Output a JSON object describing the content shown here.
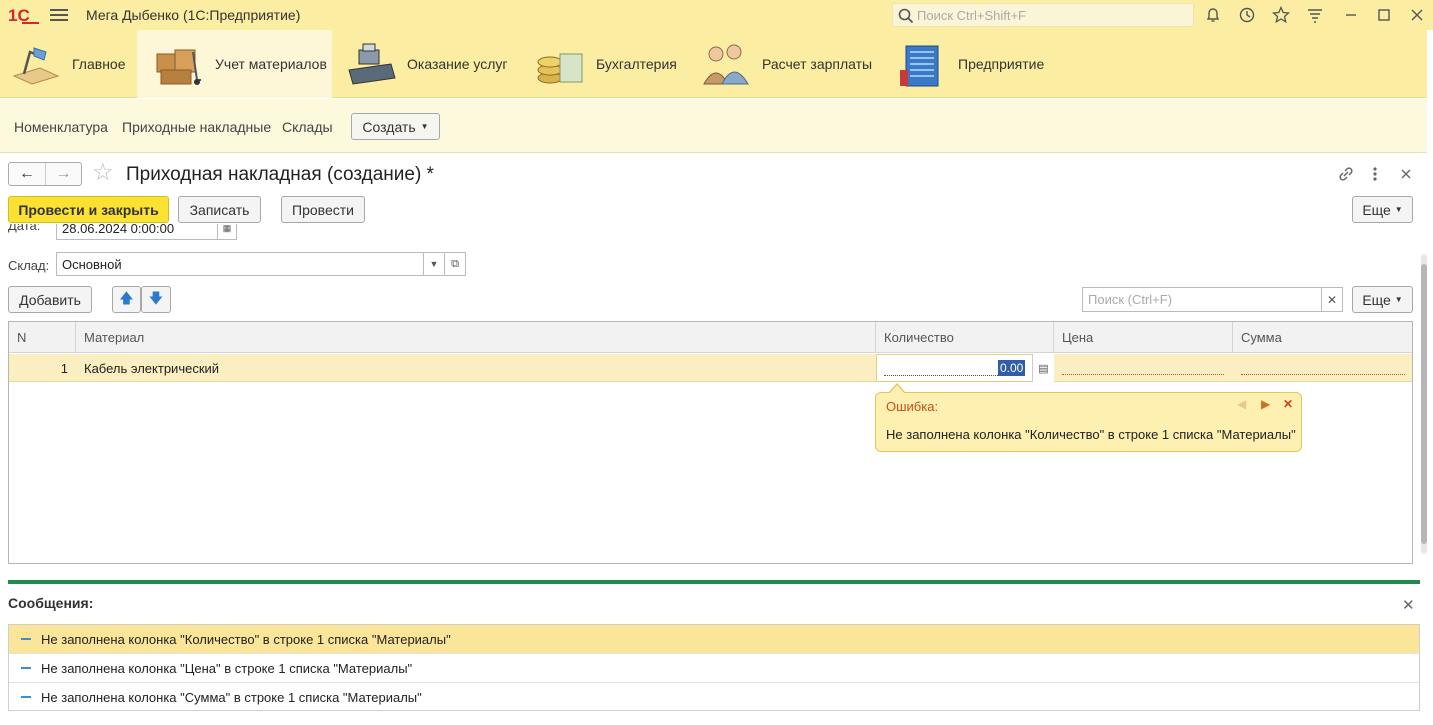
{
  "app": {
    "logo_text": "1С",
    "title": "Мега Дыбенко  (1С:Предприятие)",
    "search_placeholder": "Поиск Ctrl+Shift+F"
  },
  "sections": [
    {
      "label": "Главное",
      "icon": "desk-lamp-icon"
    },
    {
      "label": "Учет материалов",
      "icon": "boxes-cart-icon"
    },
    {
      "label": "Оказание услуг",
      "icon": "cash-register-icon"
    },
    {
      "label": "Бухгалтерия",
      "icon": "coins-icon"
    },
    {
      "label": "Расчет зарплаты",
      "icon": "people-icon"
    },
    {
      "label": "Предприятие",
      "icon": "building-icon"
    }
  ],
  "subnav": {
    "links": [
      "Номенклатура",
      "Приходные накладные",
      "Склады"
    ],
    "create_label": "Создать"
  },
  "form": {
    "title": "Приходная накладная (создание) *",
    "buttons": {
      "post_close": "Провести и закрыть",
      "save": "Записать",
      "post": "Провести",
      "more": "Еще"
    },
    "date_label": "Дата:",
    "date_value": "28.06.2024  0:00:00",
    "warehouse_label": "Склад:",
    "warehouse_value": "Основной"
  },
  "table_toolbar": {
    "add_label": "Добавить",
    "search_placeholder": "Поиск (Ctrl+F)",
    "more": "Еще"
  },
  "table": {
    "columns": [
      "N",
      "Материал",
      "Количество",
      "Цена",
      "Сумма"
    ],
    "rows": [
      {
        "n": "1",
        "material": "Кабель электрический",
        "qty": "0.00",
        "price": "",
        "sum": ""
      }
    ]
  },
  "tooltip": {
    "title": "Ошибка:",
    "message": "Не заполнена колонка \"Количество\" в строке 1 списка \"Материалы\""
  },
  "messages": {
    "title": "Сообщения:",
    "items": [
      "Не заполнена колонка \"Количество\" в строке 1 списка \"Материалы\"",
      "Не заполнена колонка \"Цена\" в строке 1 списка \"Материалы\"",
      "Не заполнена колонка \"Сумма\" в строке 1 списка \"Материалы\""
    ]
  },
  "colors": {
    "accent_yellow": "#fbe232",
    "panel_yellow": "#fbeda2",
    "error_text": "#c8501a",
    "messages_divider": "#1e8c4e"
  }
}
